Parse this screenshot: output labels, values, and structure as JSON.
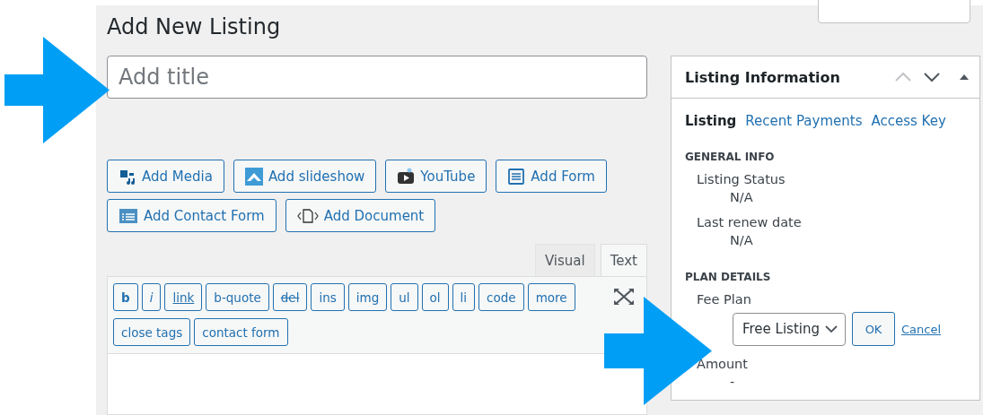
{
  "page": {
    "title": "Add New Listing"
  },
  "title_field": {
    "placeholder": "Add title"
  },
  "media_buttons": [
    {
      "label": "Add Media"
    },
    {
      "label": "Add slideshow"
    },
    {
      "label": "YouTube"
    },
    {
      "label": "Add Form"
    },
    {
      "label": "Add Contact Form"
    },
    {
      "label": "Add Document"
    }
  ],
  "editor_tabs": [
    {
      "label": "Visual",
      "selected": false
    },
    {
      "label": "Text",
      "selected": true
    }
  ],
  "quicktags": [
    {
      "label": "b",
      "kind": "bold"
    },
    {
      "label": "i",
      "kind": "italic"
    },
    {
      "label": "link",
      "kind": "underline"
    },
    {
      "label": "b-quote",
      "kind": "plain"
    },
    {
      "label": "del",
      "kind": "strike"
    },
    {
      "label": "ins",
      "kind": "plain"
    },
    {
      "label": "img",
      "kind": "plain"
    },
    {
      "label": "ul",
      "kind": "plain"
    },
    {
      "label": "ol",
      "kind": "plain"
    },
    {
      "label": "li",
      "kind": "plain"
    },
    {
      "label": "code",
      "kind": "plain"
    },
    {
      "label": "more",
      "kind": "plain"
    },
    {
      "label": "close tags",
      "kind": "plain"
    },
    {
      "label": "contact form",
      "kind": "plain"
    }
  ],
  "sidebar": {
    "title": "Listing Information",
    "tabs": [
      {
        "label": "Listing",
        "selected": true
      },
      {
        "label": "Recent Payments",
        "selected": false
      },
      {
        "label": "Access Key",
        "selected": false
      }
    ],
    "sections": [
      {
        "heading": "GENERAL INFO",
        "fields": [
          {
            "label": "Listing Status",
            "value": "N/A"
          },
          {
            "label": "Last renew date",
            "value": "N/A"
          }
        ]
      },
      {
        "heading": "PLAN DETAILS",
        "fields": [
          {
            "label": "Fee Plan",
            "kind": "select",
            "value": "Free Listing",
            "ok": "OK",
            "cancel": "Cancel"
          },
          {
            "label": "Amount",
            "value": "-"
          }
        ]
      }
    ]
  }
}
